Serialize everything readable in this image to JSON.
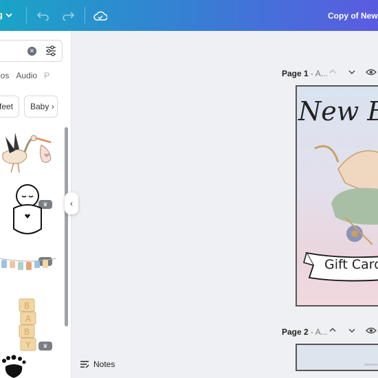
{
  "topbar": {
    "file_label": "g",
    "title": "Copy of New B"
  },
  "sidebar": {
    "search_placeholder": "",
    "tabs": [
      "eos",
      "Audio",
      "P"
    ],
    "chips": [
      "feet",
      "Baby"
    ],
    "premium_badge": "♛"
  },
  "canvas": {
    "page1_label": "Page 1",
    "page1_title": "- A...",
    "page2_label": "Page 2",
    "page2_title": "- A...",
    "design_heading": "New B",
    "design_banner": "Gift Card"
  },
  "footer": {
    "notes_label": "Notes"
  },
  "colors": {
    "topbar_start": "#1aa4c6",
    "topbar_end": "#5b5be0",
    "canvas_bg": "#eef0f3"
  }
}
